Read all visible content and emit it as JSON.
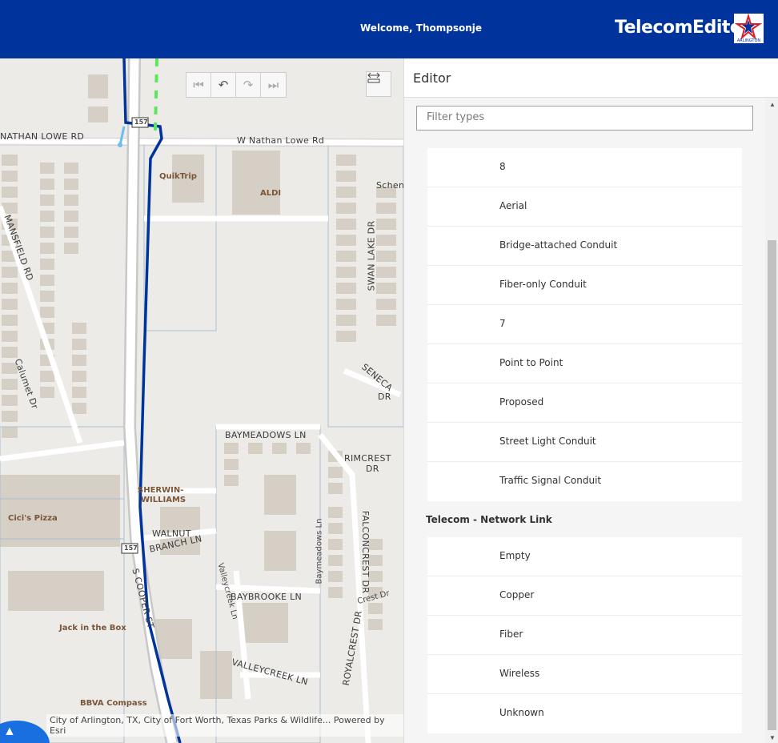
{
  "header": {
    "welcome_text": "Welcome, Thompsonje",
    "app_title": "TelecomEditor",
    "logo_text": "ARLINGTON",
    "background_color": "#00349c"
  },
  "map": {
    "nav_buttons": [
      {
        "icon": "first-icon",
        "glyph": "⏮"
      },
      {
        "icon": "undo-icon",
        "glyph": "↶"
      },
      {
        "icon": "redo-icon",
        "glyph": "↷"
      },
      {
        "icon": "last-icon",
        "glyph": "⏭"
      }
    ],
    "measure_icon": "measure-icon",
    "attribution": "City of Arlington, TX, City of Fort Worth, Texas Parks & Wildlife...   Powered by Esri",
    "labels": {
      "nathan_lowe_rd": "NATHAN LOWE RD",
      "w_nathan_lowe_rd": "W Nathan Lowe Rd",
      "mansfield_rd": "MANSFIELD RD",
      "calumet_dr": "Calumet Dr",
      "schen": "Schen",
      "swan_lake_dr": "SWAN LAKE DR",
      "seneca_dr_1": "SENECA",
      "seneca_dr_2": "DR",
      "baymeadows_ln": "BAYMEADOWS LN",
      "rimcrest_dr_1": "RIMCREST",
      "rimcrest_dr_2": "DR",
      "falconcrest_dr": "FALCONCREST DR",
      "baymeadows_ln_v": "Baymeadows Ln",
      "walnut_branch_ln_1": "WALNUT",
      "walnut_branch_ln_2": "BRANCH LN",
      "s_cooper_st": "S COOPER ST",
      "valleycreek_ln": "Valleycreek Ln",
      "baybrooke_ln": "BAYBROOKE LN",
      "valleycreek_ln_2": "VALLEYCREEK LN",
      "royalcrest_dr": "ROYALCREST DR",
      "crest_dr": "Crest Dr",
      "quiktrip": "QuikTrip",
      "aldi": "ALDI",
      "sherwin_1": "SHERWIN-",
      "sherwin_2": "WILLIAMS",
      "cicis": "Cici's Pizza",
      "jack_in_the_box": "Jack in the Box",
      "bbva": "BBVA Compass",
      "shield_1": "157",
      "shield_2": "157"
    }
  },
  "editor": {
    "title": "Editor",
    "filter_placeholder": "Filter types",
    "types": [
      {
        "label": "8",
        "color": "#000000",
        "style": "solid-thin"
      },
      {
        "label": "Aerial",
        "color": "#a0694a",
        "style": "solid-thick"
      },
      {
        "label": "Bridge-attached Conduit",
        "color": "#f2c35c",
        "style": "dashed"
      },
      {
        "label": "Fiber-only Conduit",
        "color": "#ffff00",
        "style": "dashed"
      },
      {
        "label": "7",
        "color": "#00349c",
        "style": "solid-thick"
      },
      {
        "label": "Point to Point",
        "color": "#c75b90",
        "style": "dashed"
      },
      {
        "label": "Proposed",
        "color": "#000000",
        "style": "solid-thick"
      },
      {
        "label": "Street Light Conduit",
        "color": "#5fe55c",
        "style": "dashed"
      },
      {
        "label": "Traffic Signal Conduit",
        "color": "#6cbcf0",
        "style": "dashed"
      }
    ],
    "group_title": "Telecom - Network Link",
    "links": [
      {
        "label": "Empty",
        "color": "#b4b4b4"
      },
      {
        "label": "Copper",
        "color": "#e09b13"
      },
      {
        "label": "Fiber",
        "color": "#3f7fd1"
      },
      {
        "label": "Wireless",
        "color": "#ffff33"
      },
      {
        "label": "Unknown",
        "color": "#e8201c"
      }
    ]
  }
}
